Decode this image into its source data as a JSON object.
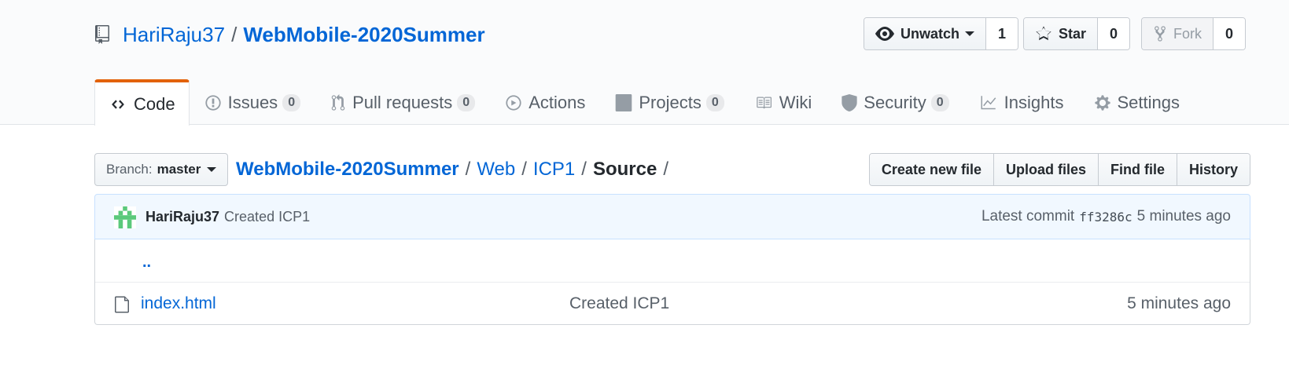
{
  "repo": {
    "owner": "HariRaju37",
    "separator": "/",
    "name": "WebMobile-2020Summer"
  },
  "actions": {
    "watch": {
      "label": "Unwatch",
      "count": "1"
    },
    "star": {
      "label": "Star",
      "count": "0"
    },
    "fork": {
      "label": "Fork",
      "count": "0"
    }
  },
  "tabs": [
    {
      "label": "Code",
      "icon": "code-icon"
    },
    {
      "label": "Issues",
      "count": "0",
      "icon": "issue-icon"
    },
    {
      "label": "Pull requests",
      "count": "0",
      "icon": "pull-request-icon"
    },
    {
      "label": "Actions",
      "icon": "play-icon"
    },
    {
      "label": "Projects",
      "count": "0",
      "icon": "project-icon"
    },
    {
      "label": "Wiki",
      "icon": "book-icon"
    },
    {
      "label": "Security",
      "count": "0",
      "icon": "shield-icon"
    },
    {
      "label": "Insights",
      "icon": "graph-icon"
    },
    {
      "label": "Settings",
      "icon": "gear-icon"
    }
  ],
  "branch": {
    "prefix": "Branch:",
    "name": "master"
  },
  "breadcrumb": {
    "root": "WebMobile-2020Summer",
    "sep": "/",
    "p1": "Web",
    "p2": "ICP1",
    "current": "Source"
  },
  "file_actions": {
    "create": "Create new file",
    "upload": "Upload files",
    "find": "Find file",
    "history": "History"
  },
  "commit": {
    "author": "HariRaju37",
    "message": "Created ICP1",
    "latest_label": "Latest commit",
    "sha": "ff3286c",
    "age": "5 minutes ago"
  },
  "files": {
    "parent": "..",
    "rows": [
      {
        "name": "index.html",
        "message": "Created ICP1",
        "age": "5 minutes ago"
      }
    ]
  },
  "colors": {
    "link": "#0366d6",
    "selected_tab_accent": "#e36209",
    "commit_bg": "#f1f8ff"
  }
}
